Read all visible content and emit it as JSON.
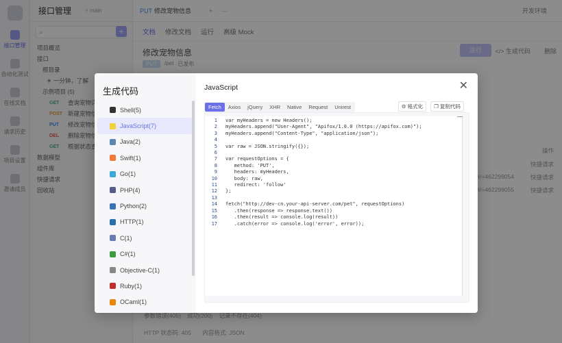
{
  "app": {
    "project_title": "接口管理",
    "branch": "main",
    "search_placeholder": "",
    "rail": [
      {
        "label": "接口管理",
        "icon": "api-icon"
      },
      {
        "label": "自动化测试",
        "icon": "robot-icon"
      },
      {
        "label": "在线文档",
        "icon": "doc-icon"
      },
      {
        "label": "请求历史",
        "icon": "history-icon"
      },
      {
        "label": "项目设置",
        "icon": "settings-icon"
      },
      {
        "label": "邀请成员",
        "icon": "user-icon"
      }
    ],
    "tree": [
      {
        "method": "",
        "label": "项目概览"
      },
      {
        "method": "",
        "label": "接口"
      },
      {
        "method": "",
        "label": "根目录"
      },
      {
        "method": "",
        "label": "☀ 一分钟，了解"
      },
      {
        "method": "",
        "label": "示例项目 (5)"
      },
      {
        "method": "GET",
        "label": "查询宠物详情"
      },
      {
        "method": "POST",
        "label": "新建宠物信息"
      },
      {
        "method": "PUT",
        "label": "修改宠物信息"
      },
      {
        "method": "DEL",
        "label": "删除宠物信息"
      },
      {
        "method": "GET",
        "label": "根据状态查"
      },
      {
        "method": "",
        "label": "数据模型"
      },
      {
        "method": "",
        "label": "组件库"
      },
      {
        "method": "",
        "label": "快捷请求"
      },
      {
        "method": "",
        "label": "回收站"
      }
    ],
    "top_tab": {
      "method": "PUT",
      "label": "修改宠物信息"
    },
    "env": "开发环境",
    "subtabs": [
      "文档",
      "修改文档",
      "运行",
      "高级 Mock"
    ],
    "api_title": "修改宠物信息",
    "method": "PUT",
    "path": "/pet",
    "status": "已发布",
    "run_label": "运行",
    "gen_label": "生成代码",
    "delete_label": "删除",
    "right_col": [
      "操作",
      "快捷请求",
      "快捷请求",
      "快捷请求"
    ],
    "right_ids": [
      "#/=462299054",
      "#/=462299055"
    ],
    "footer_a": [
      "参数错误(405)",
      "成功(200)",
      "记录不存在(404)"
    ],
    "footer_b": [
      "HTTP 状态码: 405",
      "内容格式: JSON"
    ]
  },
  "modal": {
    "title": "生成代码",
    "content_title": "JavaScript",
    "languages": [
      {
        "label": "Shell(5)",
        "icon": "shell-icon",
        "color": "#333333"
      },
      {
        "label": "JavaScript(7)",
        "icon": "javascript-icon",
        "color": "#f0d13a",
        "active": true
      },
      {
        "label": "Java(2)",
        "icon": "java-icon",
        "color": "#5a86b3"
      },
      {
        "label": "Swift(1)",
        "icon": "swift-icon",
        "color": "#f0793a"
      },
      {
        "label": "Go(1)",
        "icon": "go-icon",
        "color": "#3aa8d8"
      },
      {
        "label": "PHP(4)",
        "icon": "php-icon",
        "color": "#555b8a"
      },
      {
        "label": "Python(2)",
        "icon": "python-icon",
        "color": "#3b72b5"
      },
      {
        "label": "HTTP(1)",
        "icon": "http-icon",
        "color": "#2a6fa8"
      },
      {
        "label": "C(1)",
        "icon": "c-icon",
        "color": "#6b7db0"
      },
      {
        "label": "C#(1)",
        "icon": "csharp-icon",
        "color": "#3c9b3c"
      },
      {
        "label": "Objective-C(1)",
        "icon": "objective-c-icon",
        "color": "#888888"
      },
      {
        "label": "Ruby(1)",
        "icon": "ruby-icon",
        "color": "#c0302b"
      },
      {
        "label": "OCaml(1)",
        "icon": "ocaml-icon",
        "color": "#e8850c"
      }
    ],
    "libraries": [
      "Fetch",
      "Axios",
      "jQuery",
      "XHR",
      "Native",
      "Request",
      "Unirest"
    ],
    "active_library": "Fetch",
    "format_label": "格式化",
    "copy_label": "复制代码",
    "code_lines": [
      "var myHeaders = new Headers();",
      "myHeaders.append(\"User-Agent\", \"Apifox/1.0.0 (https://apifox.com)\");",
      "myHeaders.append(\"Content-Type\", \"application/json\");",
      "",
      "var raw = JSON.stringify({});",
      "",
      "var requestOptions = {",
      "   method: 'PUT',",
      "   headers: myHeaders,",
      "   body: raw,",
      "   redirect: 'follow'",
      "};",
      "",
      "fetch(\"http://dev-cn.your-api-server.com/pet\", requestOptions)",
      "   .then(response => response.text())",
      "   .then(result => console.log(result))",
      "   .catch(error => console.log('error', error));"
    ]
  }
}
